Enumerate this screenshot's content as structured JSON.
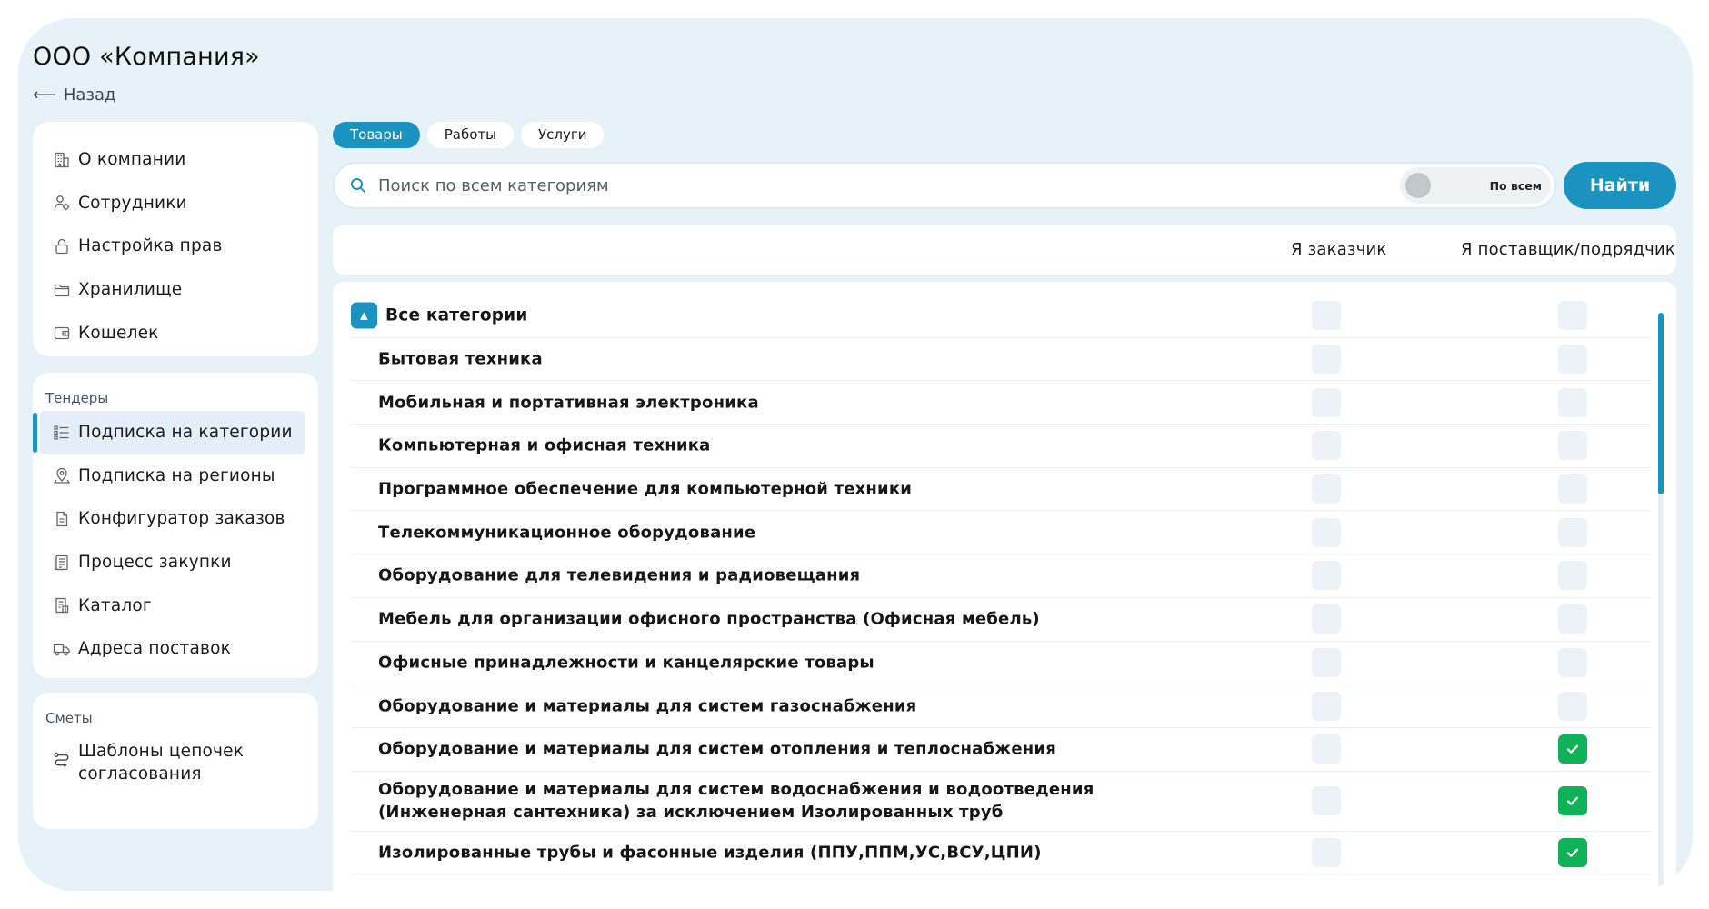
{
  "header": {
    "company_title": "ООО «Компания»",
    "back_label": "Назад"
  },
  "sidebar": {
    "main_items": [
      {
        "label": "О компании",
        "icon": "building-icon"
      },
      {
        "label": "Сотрудники",
        "icon": "employees-icon"
      },
      {
        "label": "Настройка прав",
        "icon": "lock-icon"
      },
      {
        "label": "Хранилище",
        "icon": "folder-icon"
      },
      {
        "label": "Кошелек",
        "icon": "wallet-icon"
      }
    ],
    "tenders": {
      "title": "Тендеры",
      "items": [
        {
          "label": "Подписка на категории",
          "icon": "list-icon",
          "active": true
        },
        {
          "label": "Подписка на регионы",
          "icon": "location-pin-icon"
        },
        {
          "label": "Конфигуратор заказов",
          "icon": "document-icon"
        },
        {
          "label": "Процесс закупки",
          "icon": "receipt-icon"
        },
        {
          "label": "Каталог",
          "icon": "catalog-icon"
        },
        {
          "label": "Адреса поставок",
          "icon": "truck-icon"
        }
      ]
    },
    "estimates": {
      "title": "Сметы",
      "items": [
        {
          "label_line1": "Шаблоны цепочек",
          "label_line2": "согласования",
          "icon": "route-icon"
        }
      ]
    }
  },
  "tabs": [
    "Товары",
    "Работы",
    "Услуги"
  ],
  "active_tab": "Товары",
  "search": {
    "placeholder": "Поиск по всем категориям",
    "value": "",
    "toggle_label": "По всем",
    "toggle_on": false,
    "button_label": "Найти"
  },
  "table": {
    "columns": {
      "customer": "Я заказчик",
      "supplier": "Я поставщик/подрядчик"
    },
    "root": {
      "label": "Все категории",
      "customer": false,
      "supplier": false
    },
    "rows": [
      {
        "label": "Бытовая техника",
        "customer": false,
        "supplier": false
      },
      {
        "label": "Мобильная и портативная электроника",
        "customer": false,
        "supplier": false
      },
      {
        "label": "Компьютерная и офисная техника",
        "customer": false,
        "supplier": false
      },
      {
        "label": "Программное обеспечение для компьютерной техники",
        "customer": false,
        "supplier": false
      },
      {
        "label": "Телекоммуникационное оборудование",
        "customer": false,
        "supplier": false
      },
      {
        "label": "Оборудование для телевидения и радиовещания",
        "customer": false,
        "supplier": false
      },
      {
        "label": "Мебель для организации офисного пространства (Офисная мебель)",
        "customer": false,
        "supplier": false
      },
      {
        "label": "Офисные принадлежности и канцелярские товары",
        "customer": false,
        "supplier": false
      },
      {
        "label": "Оборудование и материалы для систем газоснабжения",
        "customer": false,
        "supplier": false
      },
      {
        "label": "Оборудование и материалы для систем отопления и теплоснабжения",
        "customer": false,
        "supplier": true
      },
      {
        "label_line1": "Оборудование и материалы для систем водоснабжения и водоотведения",
        "label_line2": "(Инженерная сантехника) за исключением Изолированных труб",
        "customer": false,
        "supplier": true
      },
      {
        "label": "Изолированные трубы и фасонные изделия (ППУ,ППМ,УС,ВСУ,ЦПИ)",
        "customer": false,
        "supplier": true
      }
    ]
  },
  "colors": {
    "accent": "#1a93c0",
    "checked": "#10b257",
    "background": "#e7f1f8"
  }
}
